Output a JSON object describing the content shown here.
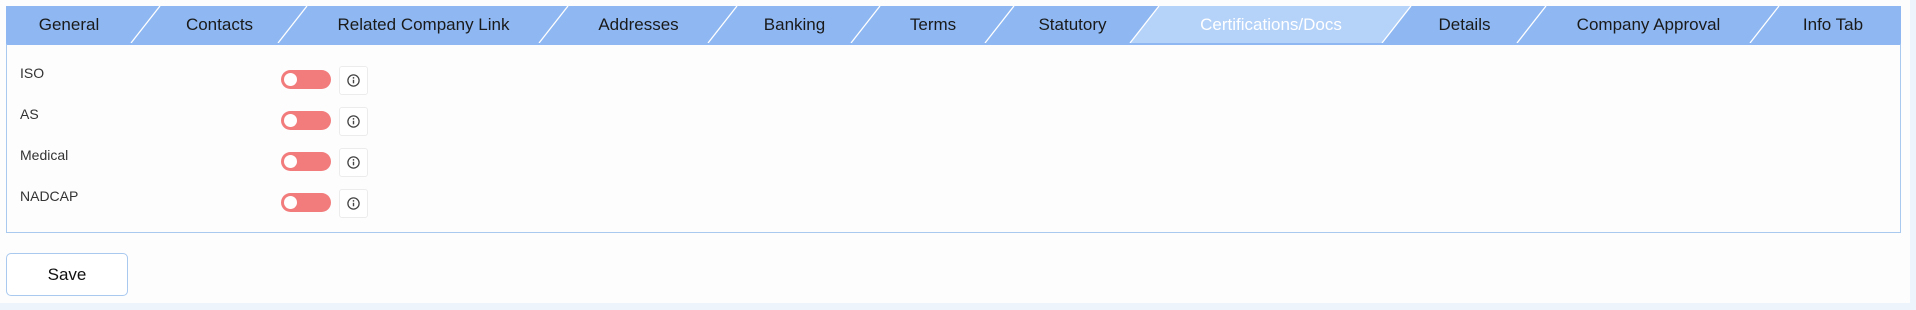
{
  "tabs": [
    {
      "label": "General",
      "active": false
    },
    {
      "label": "Contacts",
      "active": false
    },
    {
      "label": "Related Company Link",
      "active": false
    },
    {
      "label": "Addresses",
      "active": false
    },
    {
      "label": "Banking",
      "active": false
    },
    {
      "label": "Terms",
      "active": false
    },
    {
      "label": "Statutory",
      "active": false
    },
    {
      "label": "Certifications/Docs",
      "active": true
    },
    {
      "label": "Details",
      "active": false
    },
    {
      "label": "Company Approval",
      "active": false
    },
    {
      "label": "Info Tab",
      "active": false
    }
  ],
  "certifications": [
    {
      "label": "ISO",
      "enabled": false
    },
    {
      "label": "AS",
      "enabled": false
    },
    {
      "label": "Medical",
      "enabled": false
    },
    {
      "label": "NADCAP",
      "enabled": false
    }
  ],
  "toolbar": {
    "save_label": "Save"
  },
  "colors": {
    "tab_bg": "#8fb8f2",
    "tab_active_bg": "#b5d2f8",
    "toggle_off": "#f27c7c",
    "panel_border": "#a9c9ef"
  },
  "icons": {
    "info": "info-circle-icon"
  }
}
